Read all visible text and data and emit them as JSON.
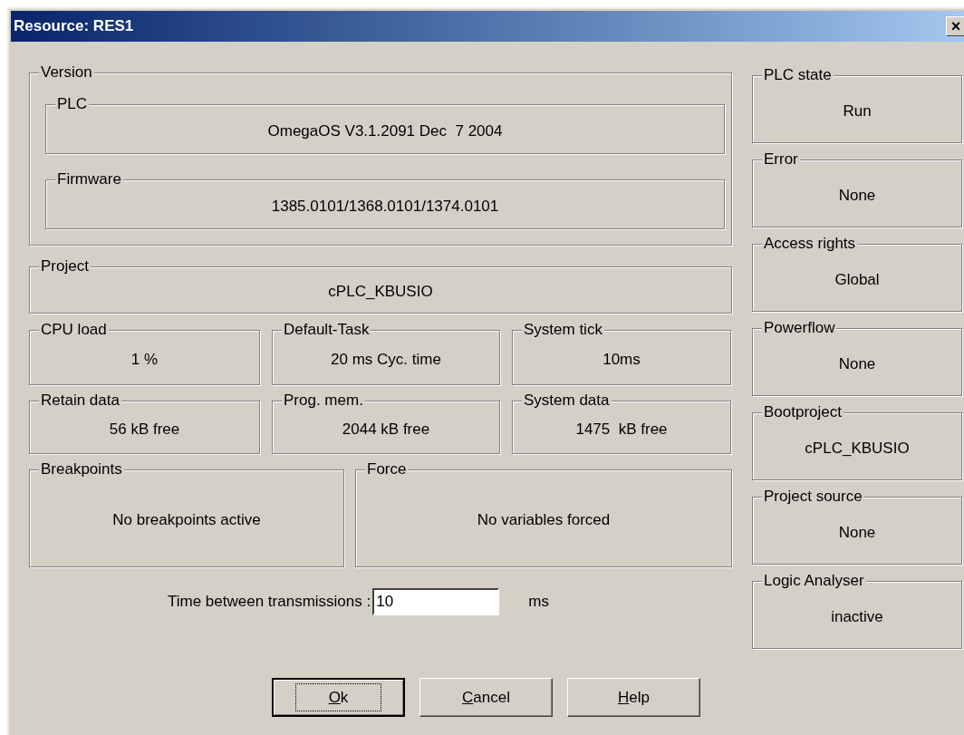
{
  "window": {
    "title": "Resource: RES1",
    "close": "×"
  },
  "version": {
    "label": "Version",
    "groups": [
      {
        "label": "PLC",
        "value": "OmegaOS V3.1.2091 Dec  7 2004"
      },
      {
        "label": "Firmware",
        "value": "1385.0101/1368.0101/1374.0101"
      }
    ]
  },
  "project": {
    "label": "Project",
    "value": "cPLC_KBUSIO"
  },
  "metrics": [
    [
      {
        "label": "CPU load",
        "value": "1 %"
      },
      {
        "label": "Default-Task",
        "value": "20 ms Cyc. time"
      },
      {
        "label": "System tick",
        "value": "10ms"
      }
    ],
    [
      {
        "label": "Retain data",
        "value": "56 kB free"
      },
      {
        "label": "Prog. mem.",
        "value": "2044 kB free"
      },
      {
        "label": "System data",
        "value": "1475  kB free"
      }
    ]
  ],
  "debug": [
    {
      "label": "Breakpoints",
      "value": "No breakpoints active"
    },
    {
      "label": "Force",
      "value": "No variables forced"
    }
  ],
  "status": [
    {
      "label": "PLC state",
      "value": "Run"
    },
    {
      "label": "Error",
      "value": "None"
    },
    {
      "label": "Access rights",
      "value": "Global"
    },
    {
      "label": "Powerflow",
      "value": "None"
    },
    {
      "label": "Bootproject",
      "value": "cPLC_KBUSIO"
    },
    {
      "label": "Project source",
      "value": "None"
    },
    {
      "label": "Logic Analyser",
      "value": "inactive"
    }
  ],
  "transmission": {
    "label": "Time between transmissions :",
    "value": "10",
    "unit": "ms"
  },
  "buttons": [
    {
      "label": "Ok",
      "first_letter_underlined": true,
      "default": true
    },
    {
      "label": "Cancel",
      "first_letter_underlined": true,
      "default": false
    },
    {
      "label": "Help",
      "first_letter_underlined": true,
      "default": false
    }
  ]
}
